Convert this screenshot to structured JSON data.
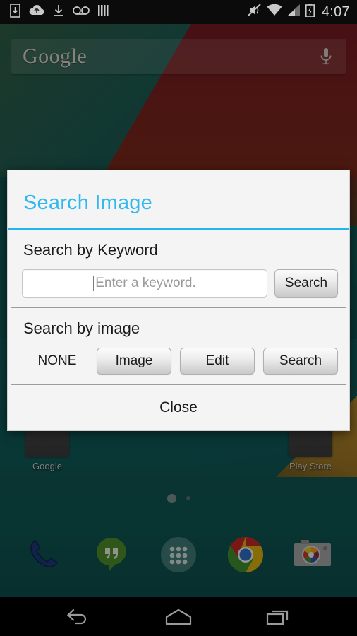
{
  "status_bar": {
    "clock": "4:07",
    "left_icons": [
      {
        "name": "save-to-device-icon"
      },
      {
        "name": "cloud-upload-icon"
      },
      {
        "name": "download-icon"
      },
      {
        "name": "voicemail-icon"
      },
      {
        "name": "equalizer-bars-icon"
      }
    ],
    "right_icons": [
      {
        "name": "volume-mute-icon"
      },
      {
        "name": "wifi-icon"
      },
      {
        "name": "cellular-signal-icon"
      },
      {
        "name": "battery-charging-icon"
      }
    ]
  },
  "home_screen": {
    "search_widget": {
      "logo_text": "Google",
      "mic_icon": "microphone-icon"
    },
    "apps": [
      {
        "label": "Google",
        "icon": "google-folder-icon"
      },
      {
        "label": "Play Store",
        "icon": "play-store-icon"
      }
    ],
    "page_indicator": {
      "pages": 2,
      "current": 1
    },
    "dock": [
      {
        "label": "Phone",
        "icon": "phone-icon"
      },
      {
        "label": "Hangouts",
        "icon": "hangouts-icon"
      },
      {
        "label": "Apps",
        "icon": "app-drawer-icon"
      },
      {
        "label": "Chrome",
        "icon": "chrome-icon"
      },
      {
        "label": "Camera",
        "icon": "camera-icon"
      }
    ]
  },
  "dialog": {
    "title": "Search Image",
    "accent_color": "#1fb6ef",
    "keyword_section": {
      "heading": "Search by Keyword",
      "input_value": "",
      "input_placeholder": "Enter a keyword.",
      "search_button": "Search"
    },
    "image_section": {
      "heading": "Search by image",
      "selected_image": "NONE",
      "image_button": "Image",
      "edit_button": "Edit",
      "search_button": "Search"
    },
    "close_button": "Close"
  },
  "nav_bar": {
    "back": "back-button",
    "home": "home-button",
    "recents": "recents-button"
  }
}
